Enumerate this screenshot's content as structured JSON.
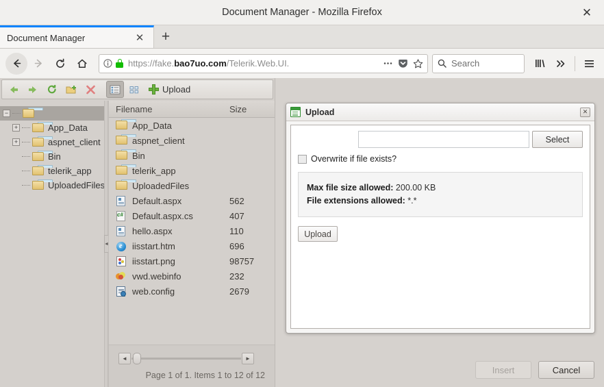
{
  "browser": {
    "window_title": "Document Manager - Mozilla Firefox",
    "close_label": "✕",
    "tab": {
      "label": "Document Manager",
      "close_label": "✕"
    },
    "new_tab_label": "+",
    "url": {
      "scheme": "https://fake.",
      "domain": "bao7uo.com",
      "path": "/Telerik.Web.UI."
    },
    "search": {
      "placeholder": "Search",
      "value": ""
    }
  },
  "filemanager": {
    "toolbar": {
      "back": "Back",
      "forward": "Forward",
      "refresh": "Refresh",
      "new_folder": "New Folder",
      "delete": "Delete",
      "list_view": "List View",
      "grid_view": "Grid View",
      "upload_label": "Upload"
    },
    "tree": {
      "root": {
        "label": "",
        "expander": "−",
        "selected": true
      },
      "items": [
        {
          "label": "App_Data",
          "expander": "+"
        },
        {
          "label": "aspnet_client",
          "expander": "+"
        },
        {
          "label": "Bin",
          "expander": ""
        },
        {
          "label": "telerik_app",
          "expander": ""
        },
        {
          "label": "UploadedFiles",
          "expander": ""
        }
      ]
    },
    "grid": {
      "columns": {
        "name": "Filename",
        "size": "Size"
      },
      "rows": [
        {
          "name": "App_Data",
          "size": "",
          "icon": "folder-icon"
        },
        {
          "name": "aspnet_client",
          "size": "",
          "icon": "folder-icon"
        },
        {
          "name": "Bin",
          "size": "",
          "icon": "folder-icon"
        },
        {
          "name": "telerik_app",
          "size": "",
          "icon": "folder-icon"
        },
        {
          "name": "UploadedFiles",
          "size": "",
          "icon": "folder-icon"
        },
        {
          "name": "Default.aspx",
          "size": "562",
          "icon": "aspx-file-icon"
        },
        {
          "name": "Default.aspx.cs",
          "size": "407",
          "icon": "csharp-file-icon"
        },
        {
          "name": "hello.aspx",
          "size": "110",
          "icon": "aspx-file-icon"
        },
        {
          "name": "iisstart.htm",
          "size": "696",
          "icon": "html-file-icon"
        },
        {
          "name": "iisstart.png",
          "size": "98757",
          "icon": "image-file-icon"
        },
        {
          "name": "vwd.webinfo",
          "size": "232",
          "icon": "webinfo-file-icon"
        },
        {
          "name": "web.config",
          "size": "2679",
          "icon": "config-file-icon"
        }
      ],
      "pager": "Page 1 of 1. Items 1 to 12 of 12",
      "scroll_left_label": "◄",
      "scroll_right_label": "►"
    },
    "splitter_label": "◄"
  },
  "dialog": {
    "title": "Upload",
    "close_label": "✕",
    "file_input": {
      "value": "",
      "placeholder": ""
    },
    "select_label": "Select",
    "overwrite": {
      "label": "Overwrite if file exists?",
      "checked": false
    },
    "info": {
      "max_size_label": "Max file size allowed:",
      "max_size_value": "200.00 KB",
      "extensions_label": "File extensions allowed:",
      "extensions_value": "*.*"
    },
    "upload_label": "Upload"
  },
  "footer": {
    "insert_label": "Insert",
    "cancel_label": "Cancel"
  },
  "colors": {
    "accent": "#0a84ff",
    "lock_green": "#12bc00",
    "upload_green": "#6cb33f",
    "chrome_bg": "#f3f2f0",
    "page_bg": "#d6d2ce"
  }
}
